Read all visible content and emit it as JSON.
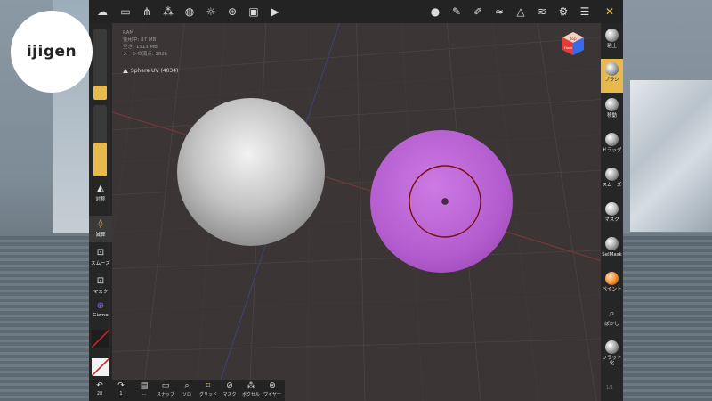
{
  "logo": {
    "text": "ijigen"
  },
  "stats": {
    "line1": "RAM",
    "line2": "使用中: 87 MB",
    "line3": "空き: 1513 MB",
    "line4": "シーンの頂点: 182k"
  },
  "scene": {
    "mesh_label": "Sphere UV (4034)"
  },
  "view_cube": {
    "top": "Top",
    "front": "Front"
  },
  "top_toolbar": {
    "icons": [
      "nomad-logo-icon",
      "folder-icon",
      "scene-graph-icon",
      "layers-icon",
      "globe-icon",
      "sun-icon",
      "material-icon",
      "image-icon",
      "video-icon",
      "material-sphere-icon",
      "brush-icon",
      "pen-icon",
      "stroke-icon",
      "triangle-icon",
      "stack-icon",
      "gear-icon",
      "menu-icon",
      "tools-icon"
    ]
  },
  "left_panel": {
    "symmetry_label": "対称",
    "subtract_label": "減算",
    "smooth_label": "スムーズ",
    "mask_label": "マスク",
    "gizmo_label": "Gizmo",
    "radius_fraction": 0.25,
    "intensity_fraction": 0.45
  },
  "right_panel": {
    "tools": [
      {
        "label": "粘土",
        "active": false
      },
      {
        "label": "ブラシ",
        "active": true
      },
      {
        "label": "移動",
        "active": false
      },
      {
        "label": "ドラッグ",
        "active": false
      },
      {
        "label": "スムーズ",
        "active": false
      },
      {
        "label": "マスク",
        "active": false
      },
      {
        "label": "SelMask",
        "active": false
      },
      {
        "label": "ペイント",
        "active": false
      },
      {
        "label": "ぼかし",
        "active": false
      },
      {
        "label": "フラット化",
        "active": false
      }
    ]
  },
  "bottom_toolbar": {
    "undo_count": "28",
    "redo_count": "1",
    "more_label": "...",
    "snap_label": "スナップ",
    "solo_label": "ソロ",
    "grid_label": "グリッド",
    "mask_label": "マスク",
    "voxel_label": "ボクセル",
    "wire_label": "ワイヤー"
  },
  "colors": {
    "accent": "#e8b94c",
    "viewport_bg": "#3b3635",
    "sphere_gray": "#c9c9c9",
    "sphere_purple": "#b35ccf",
    "brush_ring": "#7a0f0f"
  },
  "corner_number": "1/1"
}
